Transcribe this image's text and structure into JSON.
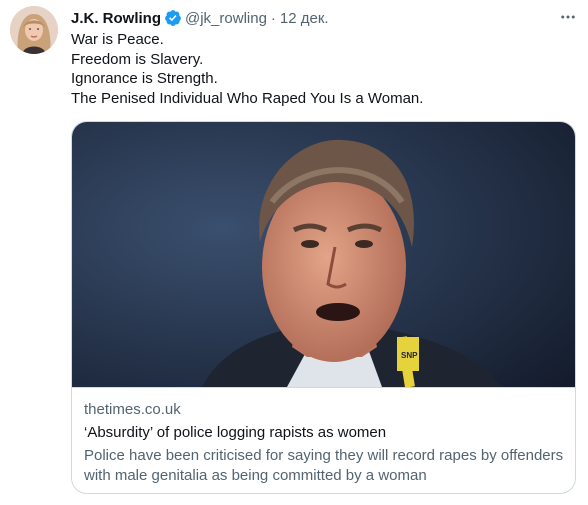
{
  "tweet": {
    "author_name": "J.K. Rowling",
    "handle": "@jk_rowling",
    "separator": "·",
    "date": "12 дек.",
    "more_icon": "more-horizontal-icon",
    "verified_icon": "verified-badge-icon",
    "lines": [
      "War is Peace.",
      "Freedom is Slavery.",
      "Ignorance is Strength.",
      "The Penised Individual Who Raped You Is a Woman."
    ]
  },
  "card": {
    "image_label": "SNP",
    "domain": "thetimes.co.uk",
    "title": "‘Absurdity’ of police logging rapists as women",
    "description": "Police have been criticised for saying they will record rapes by offenders with male genitalia as being committed by a woman"
  },
  "colors": {
    "text_primary": "#0f1419",
    "text_secondary": "#536471",
    "verified_blue": "#1d9bf0",
    "border": "#cfd9de"
  }
}
